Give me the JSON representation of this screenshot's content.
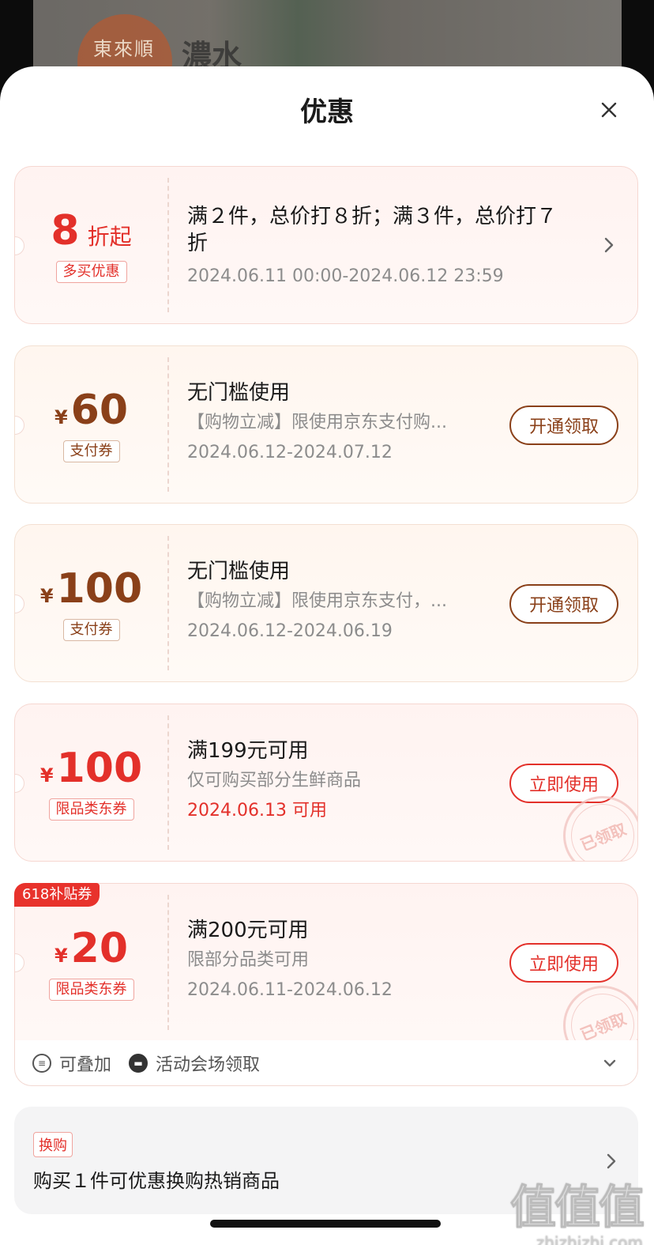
{
  "backdrop": {
    "brand_text": "東來順",
    "product_text": "濃水"
  },
  "sheet": {
    "title": "优惠",
    "close_label": "×"
  },
  "coupons": [
    {
      "amount": "8",
      "suffix": "折起",
      "tag": "多买优惠",
      "title_line1": "满２件，总价打８折；满３件，总价打７",
      "title_line2": "折",
      "date": "2024.06.11 00:00-2024.06.12 23:59"
    },
    {
      "currency": "¥",
      "amount": "60",
      "tag": "支付券",
      "title": "无门槛使用",
      "desc": "【购物立减】限使用京东支付购...",
      "date": "2024.06.12-2024.07.12",
      "button": "开通领取"
    },
    {
      "currency": "¥",
      "amount": "100",
      "tag": "支付券",
      "title": "无门槛使用",
      "desc": "【购物立减】限使用京东支付，...",
      "date": "2024.06.12-2024.06.19",
      "button": "开通领取"
    },
    {
      "currency": "¥",
      "amount": "100",
      "tag": "限品类东券",
      "title": "满199元可用",
      "desc": "仅可购买部分生鲜商品",
      "date": "2024.06.13 可用",
      "button": "立即使用",
      "stamp": "已领取"
    },
    {
      "badge": "618补贴券",
      "currency": "¥",
      "amount": "20",
      "tag": "限品类东券",
      "title": "满200元可用",
      "desc": "限部分品类可用",
      "date": "2024.06.11-2024.06.12",
      "button": "立即使用",
      "stamp": "已领取"
    }
  ],
  "footer": {
    "stackable": "可叠加",
    "venue": "活动会场领取"
  },
  "exchange": {
    "tag": "换购",
    "text": "购买１件可优惠换购热销商品"
  },
  "watermark": {
    "logo": "值值值",
    "url": "zhizhizhi.com"
  },
  "colors": {
    "accent_red": "#e3302a",
    "accent_brown": "#8a4019"
  }
}
